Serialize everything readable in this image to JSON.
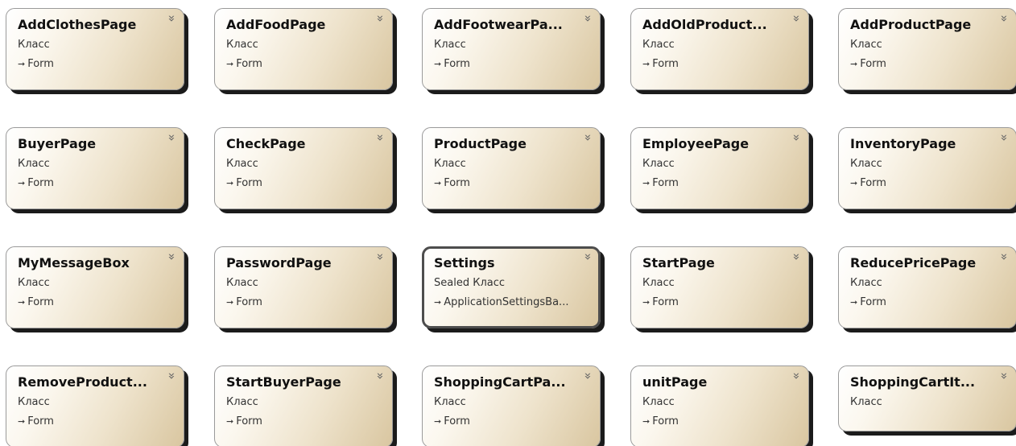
{
  "classes": [
    {
      "name": "AddClothesPage",
      "kind": "Класс",
      "base": "Form"
    },
    {
      "name": "AddFoodPage",
      "kind": "Класс",
      "base": "Form"
    },
    {
      "name": "AddFootwearPa...",
      "kind": "Класс",
      "base": "Form"
    },
    {
      "name": "AddOldProduct...",
      "kind": "Класс",
      "base": "Form"
    },
    {
      "name": "AddProductPage",
      "kind": "Класс",
      "base": "Form"
    },
    {
      "name": "BuyerPage",
      "kind": "Класс",
      "base": "Form"
    },
    {
      "name": "CheckPage",
      "kind": "Класс",
      "base": "Form"
    },
    {
      "name": "ProductPage",
      "kind": "Класс",
      "base": "Form"
    },
    {
      "name": "EmployeePage",
      "kind": "Класс",
      "base": "Form"
    },
    {
      "name": "InventoryPage",
      "kind": "Класс",
      "base": "Form"
    },
    {
      "name": "MyMessageBox",
      "kind": "Класс",
      "base": "Form"
    },
    {
      "name": "PasswordPage",
      "kind": "Класс",
      "base": "Form"
    },
    {
      "name": "Settings",
      "kind": "Sealed Класс",
      "base": "ApplicationSettingsBa...",
      "selected": true
    },
    {
      "name": "StartPage",
      "kind": "Класс",
      "base": "Form"
    },
    {
      "name": "ReducePricePage",
      "kind": "Класс",
      "base": "Form"
    },
    {
      "name": "RemoveProduct...",
      "kind": "Класс",
      "base": "Form"
    },
    {
      "name": "StartBuyerPage",
      "kind": "Класс",
      "base": "Form"
    },
    {
      "name": "ShoppingCartPa...",
      "kind": "Класс",
      "base": "Form"
    },
    {
      "name": "unitPage",
      "kind": "Класс",
      "base": "Form"
    },
    {
      "name": "ShoppingCartIt...",
      "kind": "Класс",
      "base": null
    }
  ],
  "icons": {
    "collapse": "double-chevron-down-icon",
    "inheritance": "inheritance-arrow-icon"
  },
  "colors": {
    "gradient_start": "#ffffff",
    "gradient_end": "#d9c6a0",
    "shadow": "#1b1b1b",
    "selected_border": "#4d4d4d"
  }
}
